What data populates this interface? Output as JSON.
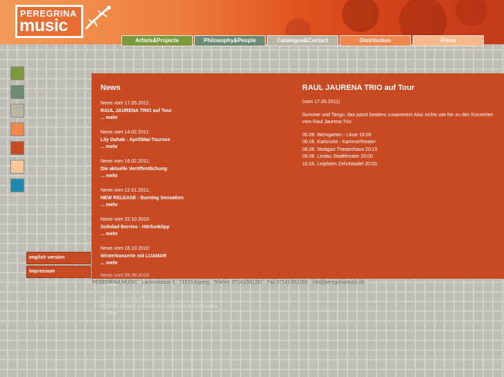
{
  "logo": {
    "top": "PEREGRINA",
    "bottom": "music"
  },
  "nav": [
    {
      "label": "Artists&Projects",
      "color": "#7b9a3e"
    },
    {
      "label": "Philosophy&People",
      "color": "#6d8a73"
    },
    {
      "label": "Catalogue&Contact",
      "color": "#b8b5a5"
    },
    {
      "label": "Distribution",
      "color": "#f0874f"
    },
    {
      "label": "Press",
      "color": "#f5b98a"
    }
  ],
  "swatches": [
    "#7b9a3e",
    "#6d8a73",
    "#b8b5a5",
    "#f0874f",
    "#c74a22",
    "#f7c99a",
    "#1d8bb0"
  ],
  "side_links": [
    "english version",
    "Impressum"
  ],
  "news": {
    "heading": "News",
    "items": [
      {
        "date": "News vom 17.05.2011:",
        "title": "RAUL JAURENA TRIO auf Tour",
        "more": "... mehr"
      },
      {
        "date": "News vom 14.02.2011:",
        "title": "Lily Dahab - April/Mai-Tournee",
        "more": "... mehr"
      },
      {
        "date": "News vom 16.02.2011:",
        "title": "Die aktuelle Veröffentlichung",
        "more": "... mehr"
      },
      {
        "date": "News vom 12.01.2011:",
        "title": "NEW RELEASE - Burning Sensation",
        "more": "... mehr"
      },
      {
        "date": "News vom 22.10.2010:",
        "title": "Soledad Berrios - Hörfunktipp",
        "more": "... mehr"
      },
      {
        "date": "News vom 18.10.2010:",
        "title": "Winterkonzerte mit LUAMAR",
        "more": "... mehr"
      }
    ],
    "overflow": [
      {
        "date": "News vom 09.08.2010:",
        "title": "",
        "more": "... mehr"
      },
      {
        "date": "News vom 17.03.2010:",
        "title": "BODEK-JANKE gewinnt den Merritim-Solistenpreis",
        "more": "... mehr"
      }
    ]
  },
  "article": {
    "title": "RAUL JAURENA TRIO auf Tour",
    "date": "(vom 17.05.2011)",
    "intro": "Sommer und Tango, das passt bestens zusammen! Also nichts wie hin zu den Konzerten vom Raul Jaurena Trio:",
    "dates": [
      "05.06. Weingarten - Linse 19:00",
      "06.06. Karlsruhe - Kammertheater",
      "08.06. Stuttgart Theaterhaus 20:15",
      "09.06. Lindau Stadttheater 20:00",
      "10.06. Leipheim Zehntstadel 20:00"
    ]
  },
  "footer": "PEREGRINA MUSIC · Lammstrasse 5 · 71679 Asperg · Telefon: 07141/661267 · Fax 07141/661268 · info@peregrinamusic.de"
}
